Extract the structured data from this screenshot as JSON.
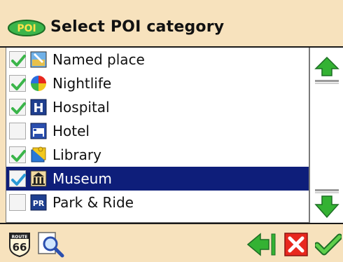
{
  "header": {
    "title": "Select POI category",
    "logo_text": "POI"
  },
  "categories": [
    {
      "label": "Named place",
      "checked": true,
      "icon": "named-place-icon",
      "selected": false
    },
    {
      "label": "Nightlife",
      "checked": true,
      "icon": "nightlife-icon",
      "selected": false
    },
    {
      "label": "Hospital",
      "checked": true,
      "icon": "hospital-icon",
      "selected": false
    },
    {
      "label": "Hotel",
      "checked": false,
      "icon": "hotel-icon",
      "selected": false
    },
    {
      "label": "Library",
      "checked": true,
      "icon": "library-icon",
      "selected": false
    },
    {
      "label": "Museum",
      "checked": true,
      "icon": "museum-icon",
      "selected": true
    },
    {
      "label": "Park & Ride",
      "checked": false,
      "icon": "park-and-ride-icon",
      "selected": false
    }
  ],
  "icon_text": {
    "hospital": "H",
    "park_and_ride": "PR"
  },
  "footer": {
    "route_badge_text": "66",
    "route_badge_top": "ROUTE"
  },
  "colors": {
    "background": "#f7e2bd",
    "selected_row": "#0e1e7a",
    "check_green": "#3bb54a",
    "arrow_green": "#34b233",
    "cancel_red": "#e8281e"
  }
}
